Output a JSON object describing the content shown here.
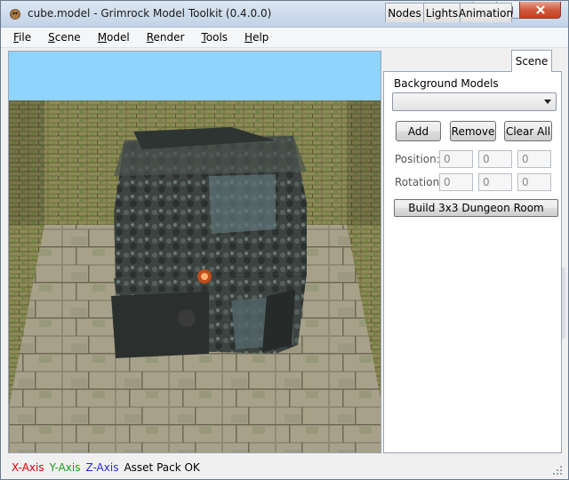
{
  "window": {
    "title": "cube.model - Grimrock Model Toolkit (0.4.0.0)",
    "icon": "grimrock-app-icon"
  },
  "menu": [
    {
      "key": "F",
      "rest": "ile"
    },
    {
      "key": "S",
      "rest": "cene"
    },
    {
      "key": "M",
      "rest": "odel"
    },
    {
      "key": "R",
      "rest": "ender"
    },
    {
      "key": "T",
      "rest": "ools"
    },
    {
      "key": "H",
      "rest": "elp"
    }
  ],
  "tabs": [
    "Nodes",
    "Lights",
    "Animation",
    "Scene"
  ],
  "active_tab": "Scene",
  "scene_panel": {
    "background_models_label": "Background Models",
    "background_models_value": "",
    "add_label": "Add",
    "remove_label": "Remove",
    "clear_all_label": "Clear All",
    "position_label": "Position:",
    "rotation_label": "Rotation:",
    "position": [
      "0",
      "0",
      "0"
    ],
    "rotation": [
      "0",
      "0",
      "0"
    ],
    "build_room_label": "Build 3x3 Dungeon Room"
  },
  "status": {
    "x_axis": "X-Axis",
    "y_axis": "Y-Axis",
    "z_axis": "Z-Axis",
    "message": "Asset Pack OK",
    "x_color": "#e00000",
    "y_color": "#1e9a1e",
    "z_color": "#2b2bd6"
  }
}
